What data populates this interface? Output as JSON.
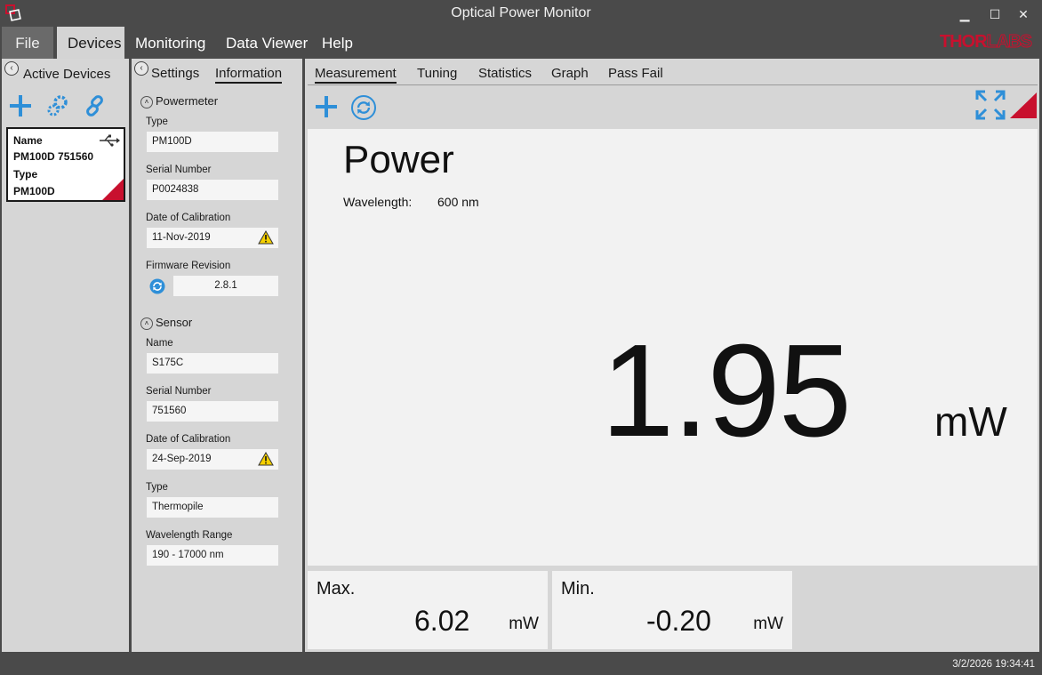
{
  "window": {
    "title": "Optical Power Monitor",
    "minimize": "▁",
    "maximize": "☐",
    "close": "✕"
  },
  "menu": {
    "file": "File",
    "devices": "Devices",
    "monitoring": "Monitoring",
    "data_viewer": "Data Viewer",
    "help": "Help"
  },
  "brand": {
    "thor": "THOR",
    "labs": "LABS"
  },
  "left_panel": {
    "title": "Active Devices",
    "device": {
      "name_label": "Name",
      "name_value": "PM100D 751560",
      "type_label": "Type",
      "type_value": "PM100D",
      "connection_icon": "usb-icon"
    }
  },
  "mid_panel": {
    "tabs": [
      "Settings",
      "Information"
    ],
    "active_tab": "Information",
    "powermeter": {
      "heading": "Powermeter",
      "type_label": "Type",
      "type_value": "PM100D",
      "serial_label": "Serial Number",
      "serial_value": "P0024838",
      "cal_label": "Date of Calibration",
      "cal_value": "11-Nov-2019",
      "fw_label": "Firmware Revision",
      "fw_value": "2.8.1"
    },
    "sensor": {
      "heading": "Sensor",
      "name_label": "Name",
      "name_value": "S175C",
      "serial_label": "Serial Number",
      "serial_value": "751560",
      "cal_label": "Date of Calibration",
      "cal_value": "24-Sep-2019",
      "type_label": "Type",
      "type_value": "Thermopile",
      "range_label": "Wavelength Range",
      "range_value": "190 - 17000 nm"
    }
  },
  "main_panel": {
    "tabs": [
      "Measurement",
      "Tuning",
      "Statistics",
      "Graph",
      "Pass Fail"
    ],
    "active_tab": "Measurement",
    "title": "Power",
    "wavelength_label": "Wavelength:",
    "wavelength_value": "600 nm",
    "value": "1.95",
    "unit": "mW",
    "max_label": "Max.",
    "max_value": "6.02",
    "max_unit": "mW",
    "min_label": "Min.",
    "min_value": "-0.20",
    "min_unit": "mW"
  },
  "status": {
    "timestamp": "3/2/2026 19:34:41"
  },
  "colors": {
    "accent_blue": "#2e8fd8",
    "brand_red": "#c8102e",
    "warning_yellow": "#f5d000"
  }
}
